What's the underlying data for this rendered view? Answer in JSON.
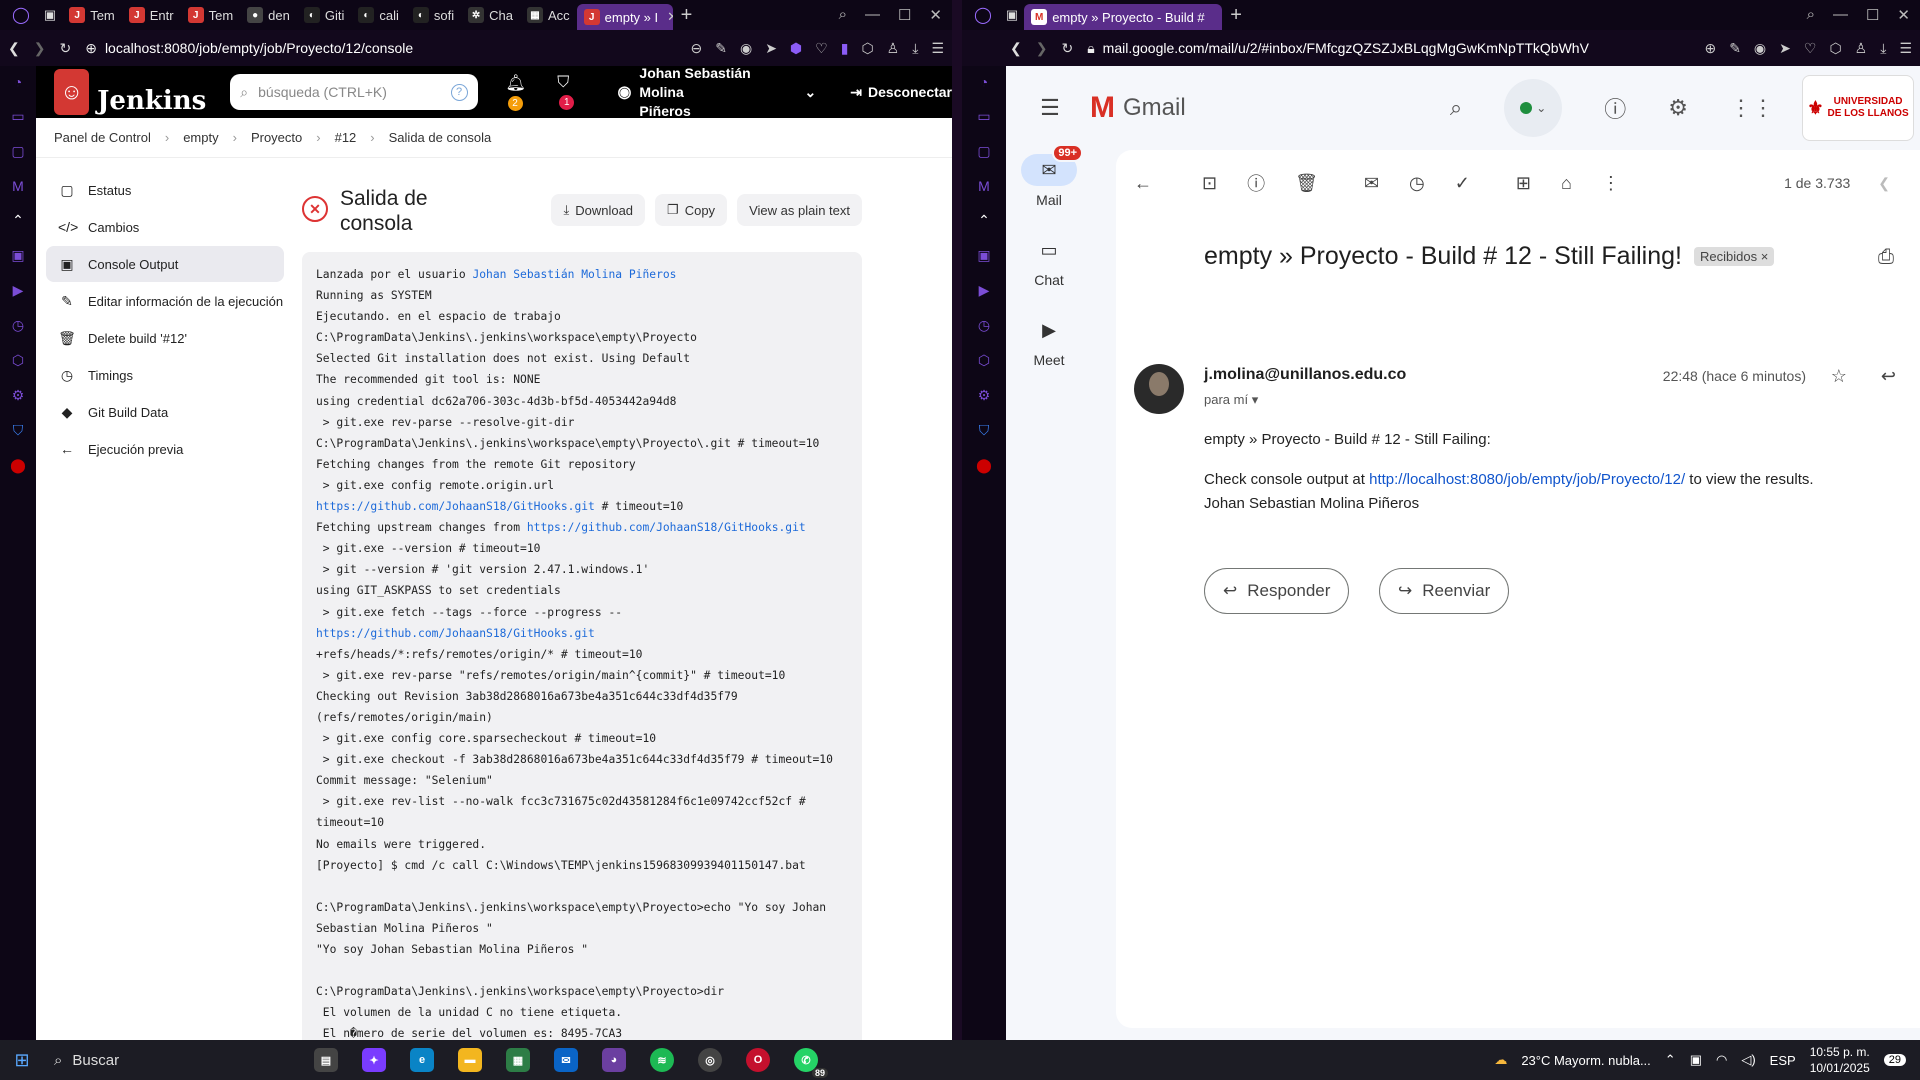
{
  "left": {
    "tabs": [
      {
        "label": "Tem",
        "color": "#d33833",
        "glyph": "J"
      },
      {
        "label": "Entr",
        "color": "#d33833",
        "glyph": "J"
      },
      {
        "label": "Tem",
        "color": "#d33833",
        "glyph": "J"
      },
      {
        "label": "den",
        "color": "#444",
        "glyph": "●"
      },
      {
        "label": "Giti",
        "color": "#222",
        "glyph": "◐"
      },
      {
        "label": "cali",
        "color": "#222",
        "glyph": "◐"
      },
      {
        "label": "sofi",
        "color": "#222",
        "glyph": "◐"
      },
      {
        "label": "Cha",
        "color": "#333",
        "glyph": "✲"
      },
      {
        "label": "Acc",
        "color": "#333",
        "glyph": "▦"
      },
      {
        "label": "empty » I",
        "color": "#d33833",
        "glyph": "J",
        "active": true
      }
    ],
    "url": "localhost:8080/job/empty/job/Proyecto/12/console",
    "jenkins": {
      "brand": "Jenkins",
      "search_placeholder": "búsqueda (CTRL+K)",
      "help": "?",
      "notif_count": "2",
      "security_count": "1",
      "user_line1": "Johan Sebastián Molina",
      "user_line2": "Piñeros",
      "logout": "Desconectar",
      "breadcrumb": [
        "Panel de Control",
        "empty",
        "Proyecto",
        "#12",
        "Salida de consola"
      ],
      "side": [
        {
          "label": "Estatus",
          "icon": "▢"
        },
        {
          "label": "Cambios",
          "icon": "</>"
        },
        {
          "label": "Console Output",
          "icon": "▣"
        },
        {
          "label": "Editar información de la ejecución",
          "icon": "✎"
        },
        {
          "label": "Delete build '#12'",
          "icon": "🗑"
        },
        {
          "label": "Timings",
          "icon": "◷"
        },
        {
          "label": "Git Build Data",
          "icon": "◆"
        },
        {
          "label": "Ejecución previa",
          "icon": "←"
        }
      ],
      "console_title": "Salida de consola",
      "download": "Download",
      "copy": "Copy",
      "plain": "View as plain text",
      "log_user_prefix": "Lanzada por el usuario ",
      "log_user": "Johan Sebastián Molina Piñeros",
      "log": [
        "Running as SYSTEM",
        "Ejecutando. en el espacio de trabajo",
        "C:\\ProgramData\\Jenkins\\.jenkins\\workspace\\empty\\Proyecto",
        "Selected Git installation does not exist. Using Default",
        "The recommended git tool is: NONE",
        "using credential dc62a706-303c-4d3b-bf5d-4053442a94d8",
        " > git.exe rev-parse --resolve-git-dir",
        "C:\\ProgramData\\Jenkins\\.jenkins\\workspace\\empty\\Proyecto\\.git # timeout=10",
        "Fetching changes from the remote Git repository",
        " > git.exe config remote.origin.url",
        "@@https://github.com/JohaanS18/GitHooks.git@@ # timeout=10",
        "Fetching upstream changes from @@https://github.com/JohaanS18/GitHooks.git@@",
        " > git.exe --version # timeout=10",
        " > git --version # 'git version 2.47.1.windows.1'",
        "using GIT_ASKPASS to set credentials",
        " > git.exe fetch --tags --force --progress --",
        "@@https://github.com/JohaanS18/GitHooks.git@@",
        "+refs/heads/*:refs/remotes/origin/* # timeout=10",
        " > git.exe rev-parse \"refs/remotes/origin/main^{commit}\" # timeout=10",
        "Checking out Revision 3ab38d2868016a673be4a351c644c33df4d35f79",
        "(refs/remotes/origin/main)",
        " > git.exe config core.sparsecheckout # timeout=10",
        " > git.exe checkout -f 3ab38d2868016a673be4a351c644c33df4d35f79 # timeout=10",
        "Commit message: \"Selenium\"",
        " > git.exe rev-list --no-walk fcc3c731675c02d43581284f6c1e09742ccf52cf #",
        "timeout=10",
        "No emails were triggered.",
        "[Proyecto] $ cmd /c call C:\\Windows\\TEMP\\jenkins15968309939401150147.bat",
        "",
        "C:\\ProgramData\\Jenkins\\.jenkins\\workspace\\empty\\Proyecto>echo \"Yo soy Johan",
        "Sebastian Molina Piñeros \"",
        "\"Yo soy Johan Sebastian Molina Piñeros \"",
        "",
        "C:\\ProgramData\\Jenkins\\.jenkins\\workspace\\empty\\Proyecto>dir",
        " El volumen de la unidad C no tiene etiqueta.",
        " El n�mero de serie del volumen es: 8495-7CA3"
      ]
    }
  },
  "right": {
    "tab": "empty » Proyecto - Build #",
    "url": "mail.google.com/mail/u/2/#inbox/FMfcgzQZSZJxBLqgMgGwKmNpTTkQbWhV",
    "gmail": {
      "brand": "Gmail",
      "uni_line1": "UNIVERSIDAD",
      "uni_line2": "DE LOS LLANOS",
      "rail": [
        {
          "label": "Mail",
          "icon": "✉",
          "badge": "99+"
        },
        {
          "label": "Chat",
          "icon": "▭"
        },
        {
          "label": "Meet",
          "icon": "▶"
        }
      ],
      "count": "1 de 3.733",
      "subject": "empty » Proyecto - Build # 12 - Still Failing!",
      "label": "Recibidos",
      "sender": "j.molina@unillanos.edu.co",
      "to": "para mí",
      "time": "22:48 (hace 6 minutos)",
      "body_line1": "empty » Proyecto - Build # 12 - Still Failing:",
      "body_pre": "Check console output at ",
      "body_link": "http://localhost:8080/job/empty/job/Proyecto/12/",
      "body_post": " to view the results.",
      "body_sign": "Johan Sebastian Molina Piñeros",
      "reply": "Responder",
      "forward": "Reenviar"
    }
  },
  "taskbar": {
    "search": "Buscar",
    "weather": "23°C  Mayorm. nubla...",
    "lang": "ESP",
    "time": "10:55 p. m.",
    "date": "10/01/2025",
    "notif": "29",
    "whatsapp_badge": "89"
  }
}
